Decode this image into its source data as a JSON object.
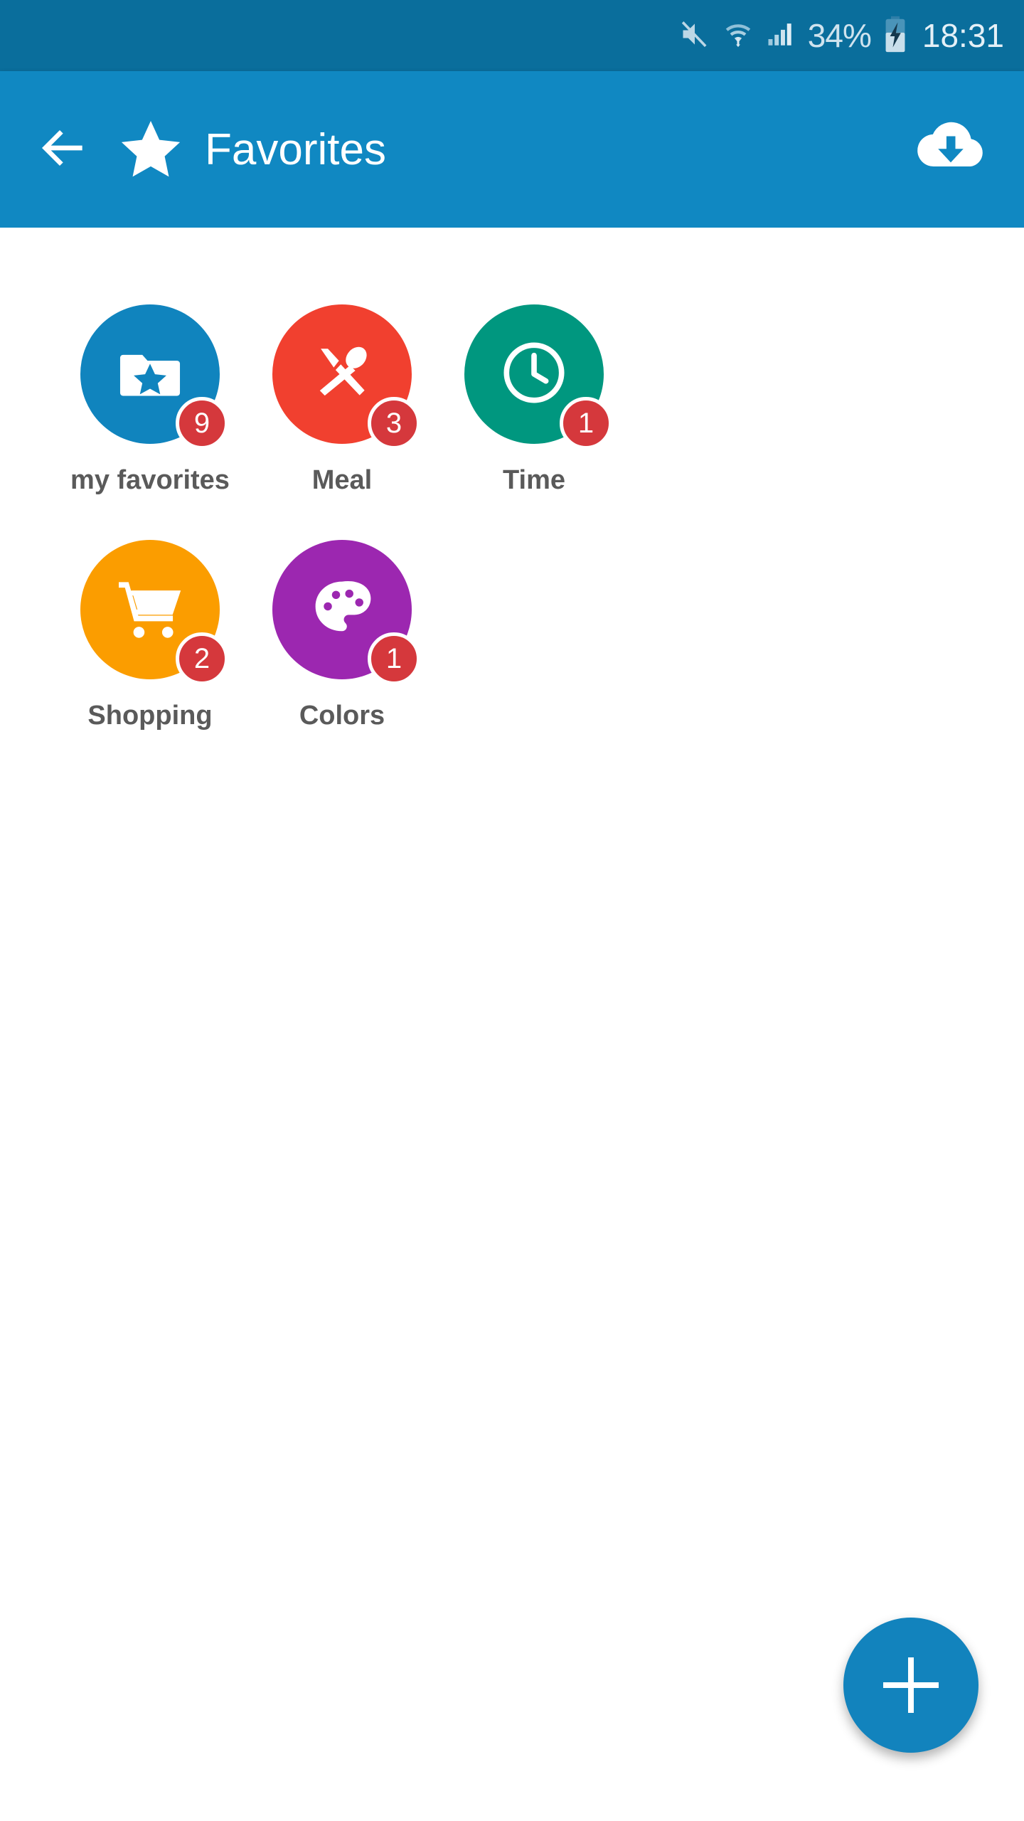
{
  "status_bar": {
    "background": "#0a6e9c",
    "icons": [
      "mute-icon",
      "wifi-icon",
      "signal-icon",
      "battery-charging-icon"
    ],
    "battery_percent": "34%",
    "clock": "18:31"
  },
  "app_bar": {
    "background": "#1088c2",
    "back_icon": "arrow-back-icon",
    "leading_icon": "star-icon",
    "title": "Favorites",
    "action_icon": "cloud-download-icon"
  },
  "grid": {
    "items": [
      {
        "label": "my favorites",
        "badge": "9",
        "color": "#1084be",
        "icon": "folder-star-icon"
      },
      {
        "label": "Meal",
        "badge": "3",
        "color": "#f1402f",
        "icon": "cutlery-icon"
      },
      {
        "label": "Time",
        "badge": "1",
        "color": "#00977f",
        "icon": "clock-icon"
      },
      {
        "label": "Shopping",
        "badge": "2",
        "color": "#fb9d00",
        "icon": "shopping-cart-icon"
      },
      {
        "label": "Colors",
        "badge": "1",
        "color": "#9c27b0",
        "icon": "palette-icon"
      }
    ],
    "badge_color": "#d5383c",
    "label_color": "#5a5a5a"
  },
  "fab": {
    "icon": "plus-icon",
    "label": "+",
    "color": "#1283bd"
  }
}
